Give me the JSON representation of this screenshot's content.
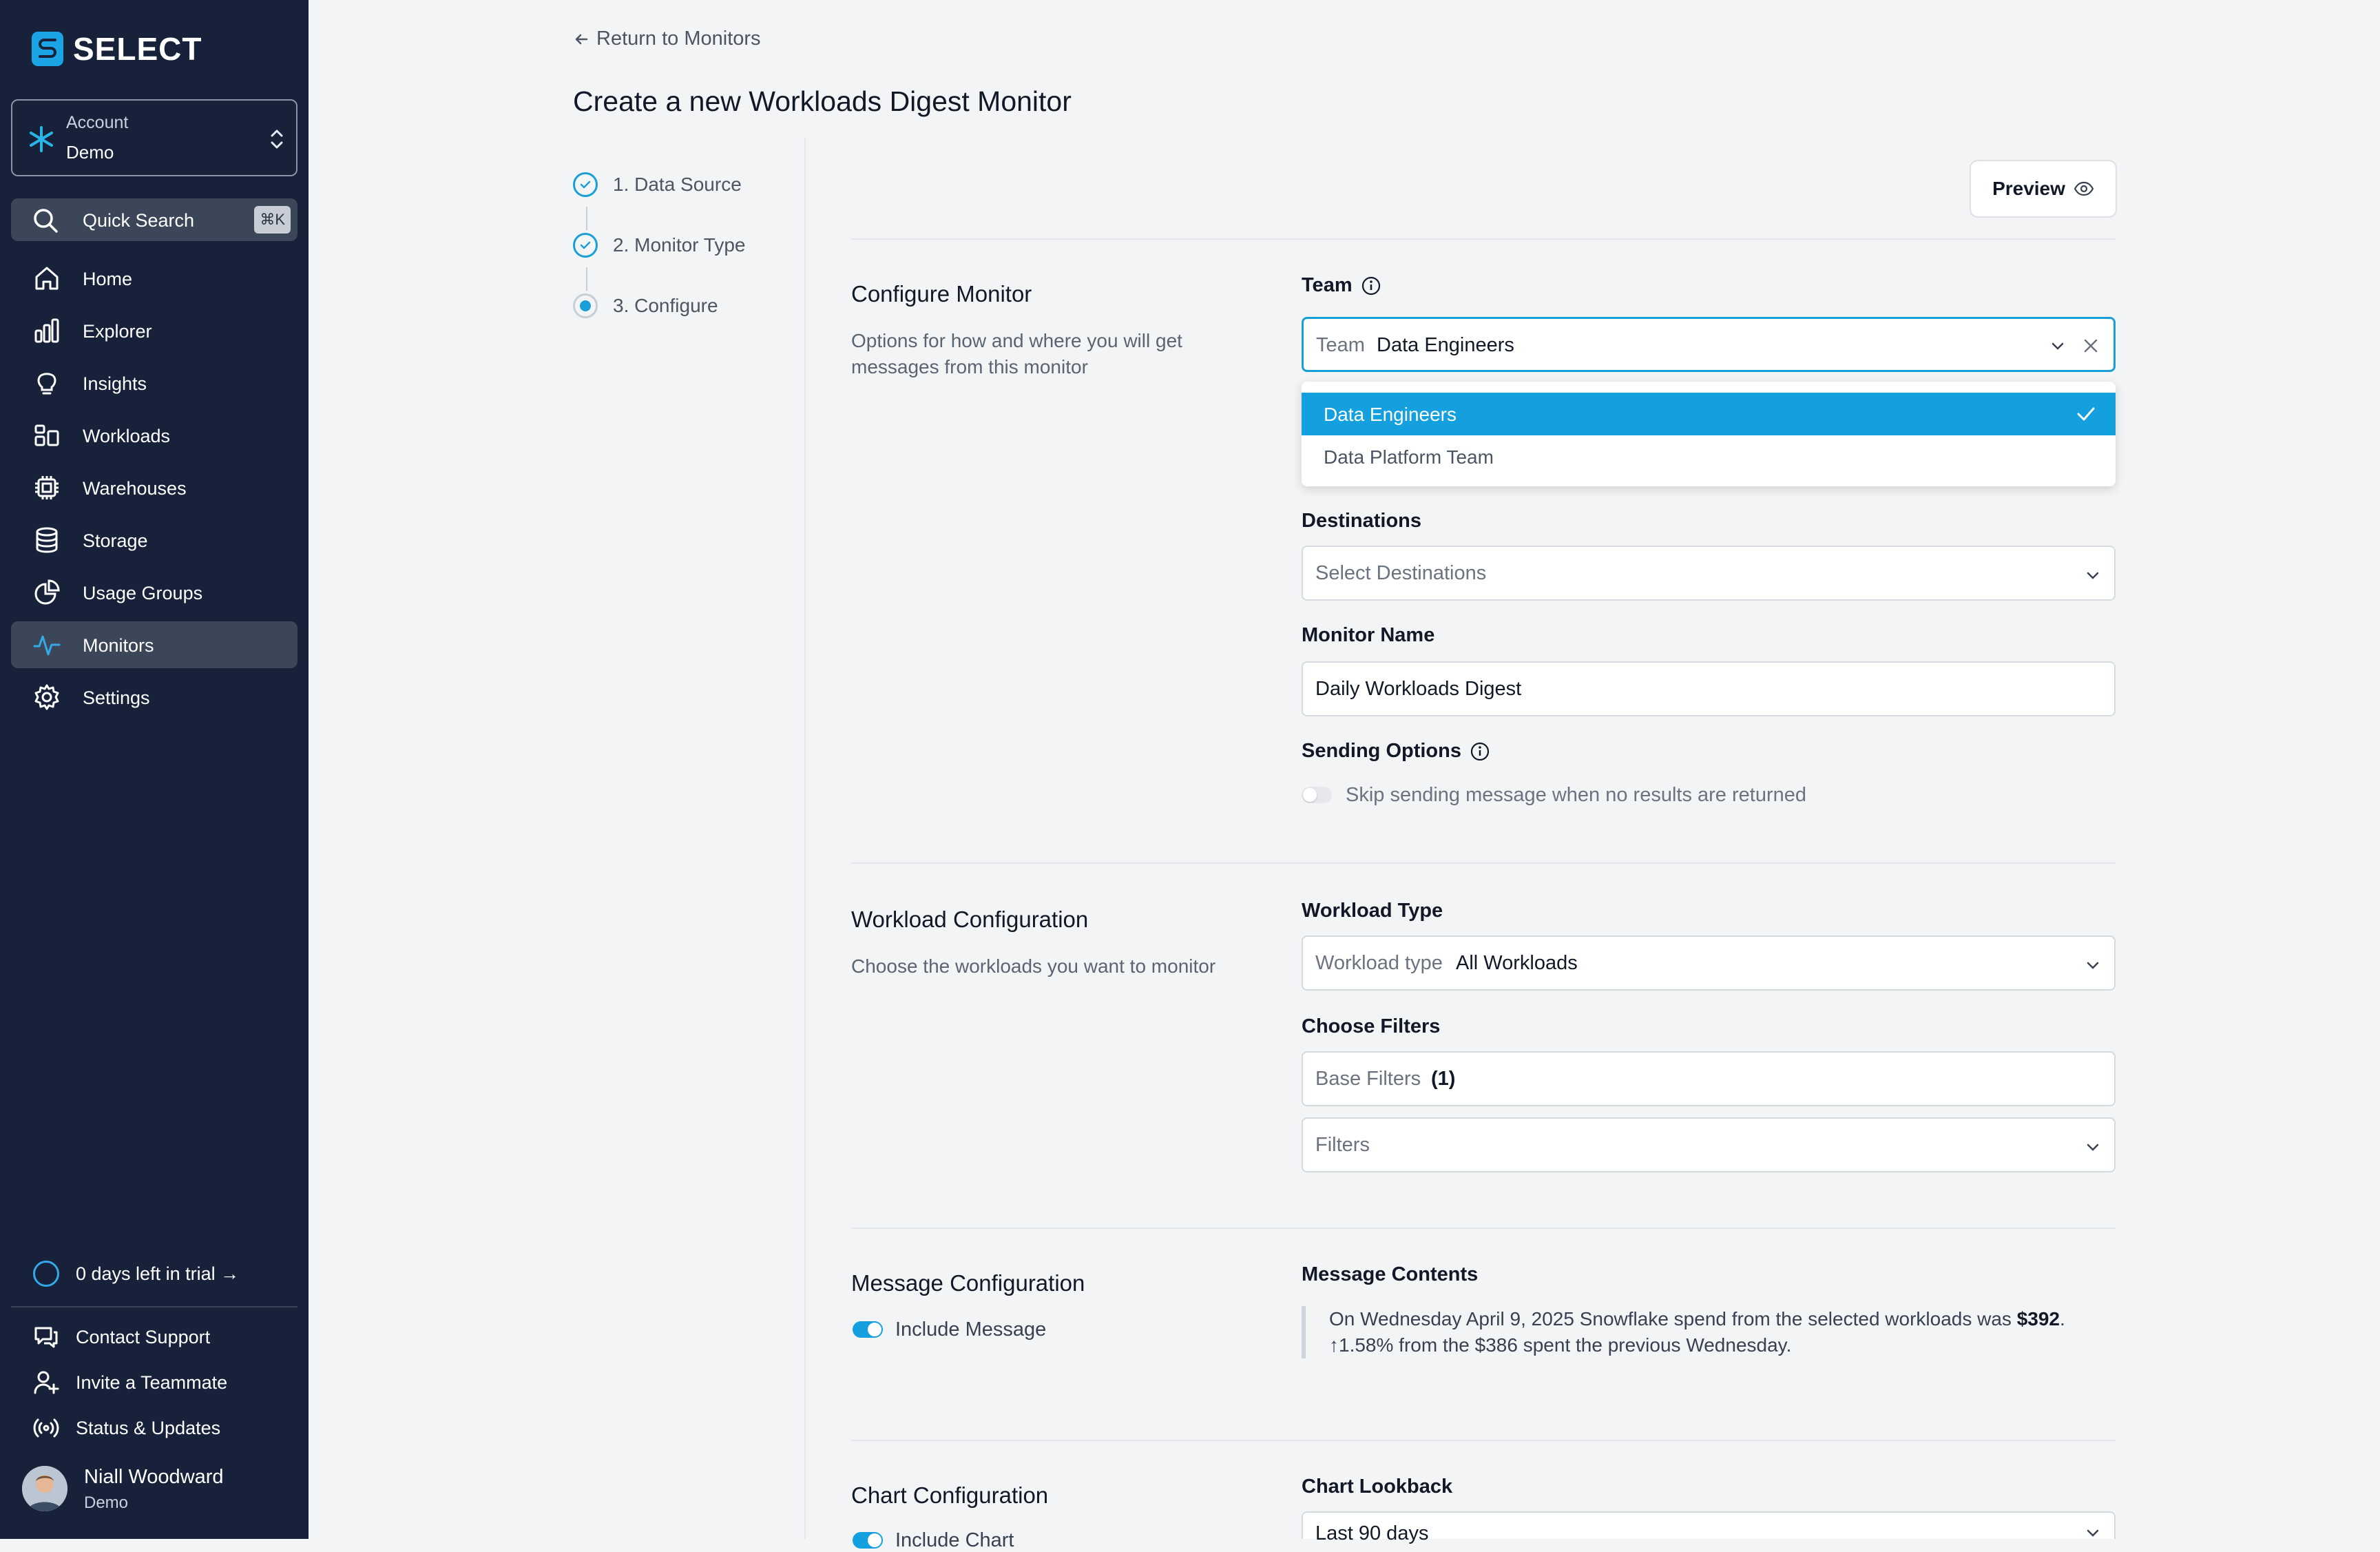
{
  "brand": {
    "name": "SELECT"
  },
  "account": {
    "label": "Account",
    "value": "Demo"
  },
  "quick_search": {
    "label": "Quick Search",
    "shortcut": "⌘K"
  },
  "nav": [
    {
      "label": "Home",
      "icon": "home-icon"
    },
    {
      "label": "Explorer",
      "icon": "bar-chart-icon"
    },
    {
      "label": "Insights",
      "icon": "lightbulb-icon"
    },
    {
      "label": "Workloads",
      "icon": "workloads-icon"
    },
    {
      "label": "Warehouses",
      "icon": "cpu-icon"
    },
    {
      "label": "Storage",
      "icon": "database-icon"
    },
    {
      "label": "Usage Groups",
      "icon": "pie-chart-icon"
    },
    {
      "label": "Monitors",
      "icon": "activity-icon",
      "active": true
    },
    {
      "label": "Settings",
      "icon": "gear-icon"
    }
  ],
  "trial": {
    "text": "0 days left in trial →"
  },
  "footer_links": [
    {
      "label": "Contact Support",
      "icon": "chat-icon"
    },
    {
      "label": "Invite a Teammate",
      "icon": "user-plus-icon"
    },
    {
      "label": "Status & Updates",
      "icon": "broadcast-icon"
    }
  ],
  "user": {
    "name": "Niall Woodward",
    "org": "Demo"
  },
  "header": {
    "back_link": "Return to Monitors",
    "title": "Create a new Workloads Digest Monitor"
  },
  "steps": [
    {
      "label": "1. Data Source",
      "status": "done"
    },
    {
      "label": "2. Monitor Type",
      "status": "done"
    },
    {
      "label": "3. Configure",
      "status": "current"
    }
  ],
  "preview_button": "Preview",
  "configure_monitor": {
    "title": "Configure Monitor",
    "description": "Options for how and where you will get messages from this monitor",
    "team_label": "Team",
    "team_field_prefix": "Team",
    "team_value": "Data Engineers",
    "team_options": [
      {
        "label": "Data Engineers",
        "selected": true
      },
      {
        "label": "Data Platform Team",
        "selected": false
      }
    ],
    "destinations_label": "Destinations",
    "destinations_placeholder": "Select Destinations",
    "monitor_name_label": "Monitor Name",
    "monitor_name_value": "Daily Workloads Digest",
    "sending_options_label": "Sending Options",
    "skip_toggle_label": "Skip sending message when no results are returned",
    "skip_toggle_on": false
  },
  "workload_configuration": {
    "title": "Workload Configuration",
    "description": "Choose the workloads you want to monitor",
    "workload_type_label": "Workload Type",
    "workload_type_prefix": "Workload type",
    "workload_type_value": "All Workloads",
    "choose_filters_label": "Choose Filters",
    "base_filters_label": "Base Filters",
    "base_filters_count": "(1)",
    "filters_placeholder": "Filters"
  },
  "message_configuration": {
    "title": "Message Configuration",
    "include_message_label": "Include Message",
    "include_message_on": true,
    "contents_label": "Message Contents",
    "message_part1": "On Wednesday April 9, 2025 Snowflake spend from the selected workloads was",
    "message_amount": "$392",
    "message_part2": ". ↑1.58% from the $386 spent the previous Wednesday."
  },
  "chart_configuration": {
    "title": "Chart Configuration",
    "include_chart_label": "Include Chart",
    "include_chart_on": true,
    "lookback_label": "Chart Lookback",
    "lookback_value": "Last 90 days"
  },
  "colors": {
    "sidebar_bg": "#17223a",
    "accent": "#14a0df",
    "page_bg": "#f3f4f5"
  }
}
